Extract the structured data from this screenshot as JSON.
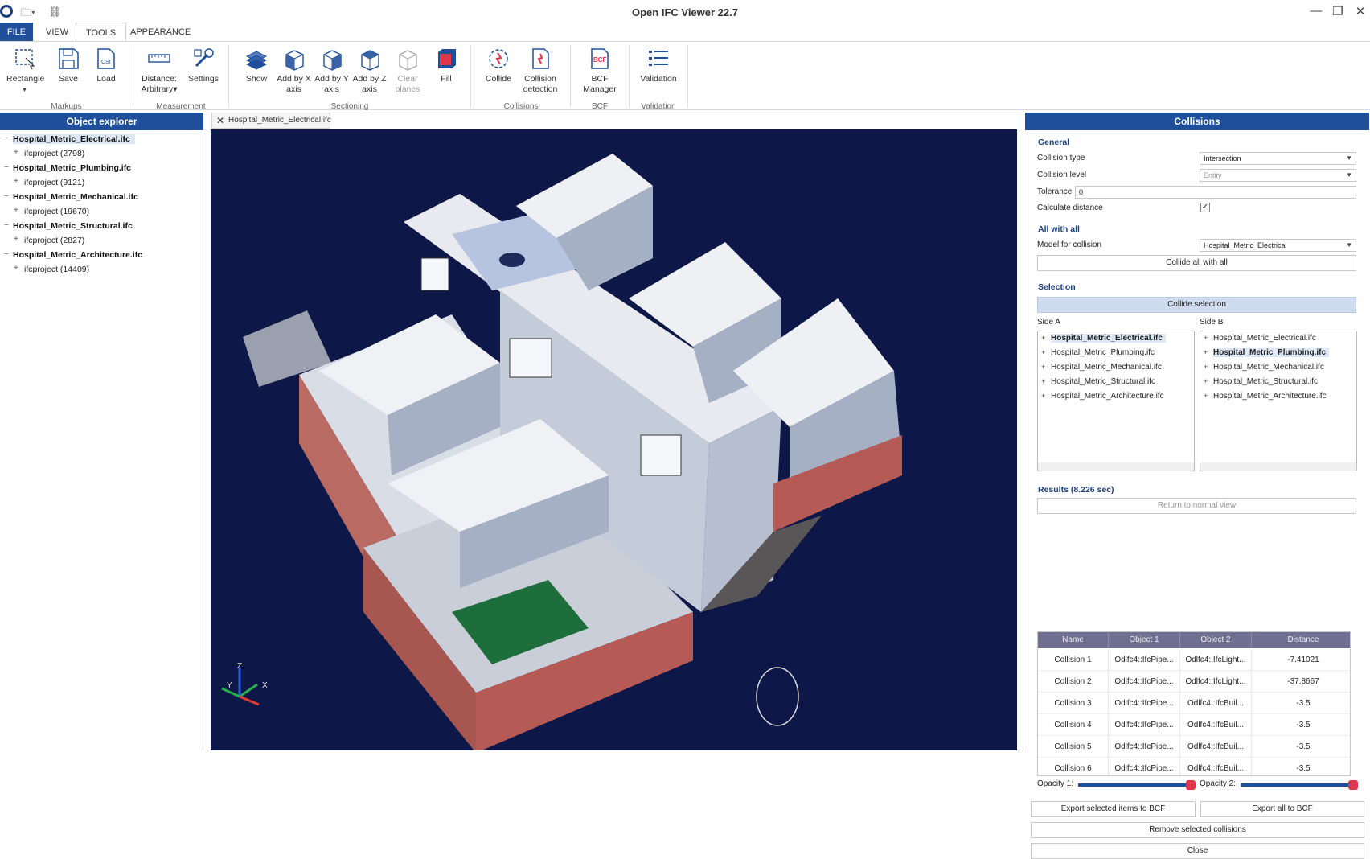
{
  "window": {
    "title": "Open IFC Viewer 22.7"
  },
  "ribbon_tabs": [
    "FILE",
    "VIEW",
    "TOOLS",
    "APPEARANCE"
  ],
  "ribbon": {
    "markups": {
      "label": "Markups",
      "buttons": [
        "Rectangle",
        "Save",
        "Load"
      ]
    },
    "measurement": {
      "label": "Measurement",
      "distance": "Distance:",
      "distance_mode": "Arbitrary",
      "settings": "Settings"
    },
    "sectioning": {
      "label": "Sectioning",
      "buttons": [
        "Show",
        "Add by X",
        "axis",
        "Add by Y",
        "axis",
        "Add by Z",
        "axis",
        "Clear",
        "planes",
        "Fill"
      ]
    },
    "collisions": {
      "label": "Collisions",
      "collide": "Collide",
      "detect1": "Collision",
      "detect2": "detection"
    },
    "bcf": {
      "label": "BCF",
      "icon_text": "BCF",
      "b1": "BCF",
      "b2": "Manager"
    },
    "validation": {
      "label": "Validation",
      "button": "Validation"
    }
  },
  "explorer": {
    "title": "Object explorer",
    "files": [
      {
        "name": "Hospital_Metric_Electrical.ifc",
        "child": "ifcproject (2798)"
      },
      {
        "name": "Hospital_Metric_Plumbing.ifc",
        "child": "ifcproject (9121)"
      },
      {
        "name": "Hospital_Metric_Mechanical.ifc",
        "child": "ifcproject (19670)"
      },
      {
        "name": "Hospital_Metric_Structural.ifc",
        "child": "ifcproject (2827)"
      },
      {
        "name": "Hospital_Metric_Architecture.ifc",
        "child": "ifcproject (14409)"
      }
    ]
  },
  "viewport": {
    "tab": "Hospital_Metric_Electrical.ifc",
    "axes": {
      "x": "X",
      "y": "Y",
      "z": "Z"
    }
  },
  "collisions": {
    "title": "Collisions",
    "general": {
      "title": "General",
      "collision_type_label": "Collision type",
      "collision_type": "Intersection",
      "collision_level_label": "Collision level",
      "collision_level": "Entity",
      "tolerance_label": "Tolerance",
      "tolerance": "0",
      "calc_distance_label": "Calculate distance",
      "calc_distance_check": "✓"
    },
    "all_with_all": {
      "title": "All with all",
      "model_label": "Model for collision",
      "model": "Hospital_Metric_Electrical",
      "button": "Collide all with all"
    },
    "selection": {
      "title": "Selection",
      "button": "Collide selection",
      "side_a_label": "Side A",
      "side_b_label": "Side B",
      "side_a": [
        "Hospital_Metric_Electrical.ifc",
        "Hospital_Metric_Plumbing.ifc",
        "Hospital_Metric_Mechanical.ifc",
        "Hospital_Metric_Structural.ifc",
        "Hospital_Metric_Architecture.ifc"
      ],
      "side_b": [
        "Hospital_Metric_Electrical.ifc",
        "Hospital_Metric_Plumbing.ifc",
        "Hospital_Metric_Mechanical.ifc",
        "Hospital_Metric_Structural.ifc",
        "Hospital_Metric_Architecture.ifc"
      ]
    },
    "results": {
      "title": "Results (8.226 sec)",
      "return_button": "Return to normal view",
      "columns": [
        "Name",
        "Object 1",
        "Object 2",
        "Distance"
      ],
      "rows": [
        [
          "Collision 1",
          "Odlfc4::IfcPipe...",
          "Odlfc4::IfcLight...",
          "-7.41021"
        ],
        [
          "Collision 2",
          "Odlfc4::IfcPipe...",
          "Odlfc4::IfcLight...",
          "-37.8667"
        ],
        [
          "Collision 3",
          "Odlfc4::IfcPipe...",
          "Odlfc4::IfcBuil...",
          "-3.5"
        ],
        [
          "Collision 4",
          "Odlfc4::IfcPipe...",
          "Odlfc4::IfcBuil...",
          "-3.5"
        ],
        [
          "Collision 5",
          "Odlfc4::IfcPipe...",
          "Odlfc4::IfcBuil...",
          "-3.5"
        ],
        [
          "Collision 6",
          "Odlfc4::IfcPipe...",
          "Odlfc4::IfcBuil...",
          "-3.5"
        ]
      ]
    },
    "opacity1_label": "Opacity 1:",
    "opacity1": 1.0,
    "opacity2_label": "Opacity 2:",
    "opacity2": 1.0,
    "export_selected": "Export selected items to BCF",
    "export_all": "Export all to BCF",
    "remove_selected": "Remove selected collisions",
    "close": "Close"
  },
  "colors": {
    "accent": "#1f4f9a",
    "viewport_bg": "#0d1848",
    "slider_knob": "#e0354b"
  }
}
